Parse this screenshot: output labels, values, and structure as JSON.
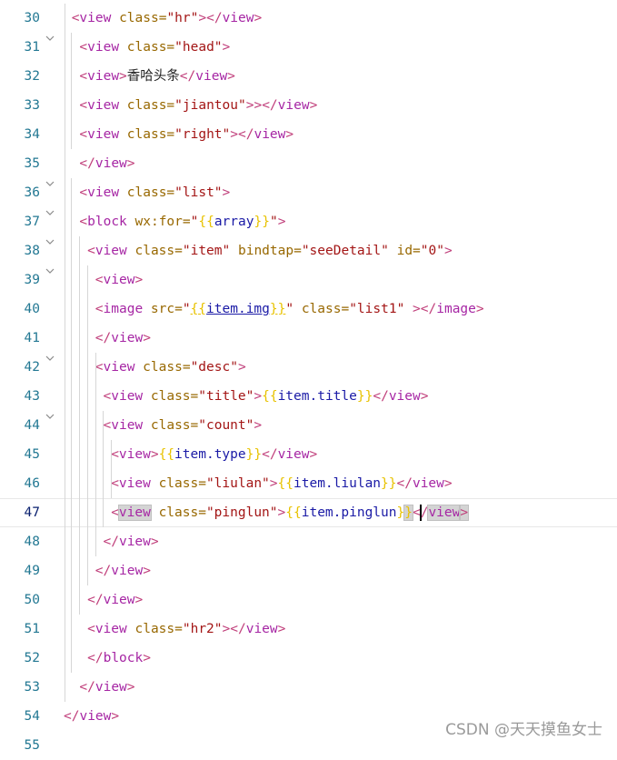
{
  "lines": [
    {
      "n": "30",
      "fold": "",
      "indent": 1,
      "tokens": [
        [
          "p",
          "<"
        ],
        [
          "t",
          "view"
        ],
        [
          "a",
          " class="
        ],
        [
          "s",
          "\"hr\""
        ],
        [
          "p",
          "></"
        ],
        [
          "t",
          "view"
        ],
        [
          "p",
          ">"
        ]
      ]
    },
    {
      "n": "31",
      "fold": "v",
      "indent": 2,
      "tokens": [
        [
          "p",
          "<"
        ],
        [
          "t",
          "view"
        ],
        [
          "a",
          " class="
        ],
        [
          "s",
          "\"head\""
        ],
        [
          "p",
          ">"
        ]
      ]
    },
    {
      "n": "32",
      "fold": "",
      "indent": 2,
      "tokens": [
        [
          "p",
          "<"
        ],
        [
          "t",
          "view"
        ],
        [
          "p",
          ">"
        ],
        [
          "x",
          "香哈头条"
        ],
        [
          "p",
          "</"
        ],
        [
          "t",
          "view"
        ],
        [
          "p",
          ">"
        ]
      ]
    },
    {
      "n": "33",
      "fold": "",
      "indent": 2,
      "tokens": [
        [
          "p",
          "<"
        ],
        [
          "t",
          "view"
        ],
        [
          "a",
          " class="
        ],
        [
          "s",
          "\"jiantou\""
        ],
        [
          "p",
          ">></"
        ],
        [
          "t",
          "view"
        ],
        [
          "p",
          ">"
        ]
      ]
    },
    {
      "n": "34",
      "fold": "",
      "indent": 2,
      "tokens": [
        [
          "p",
          "<"
        ],
        [
          "t",
          "view"
        ],
        [
          "a",
          " class="
        ],
        [
          "s",
          "\"right\""
        ],
        [
          "p",
          "></"
        ],
        [
          "t",
          "view"
        ],
        [
          "p",
          ">"
        ]
      ]
    },
    {
      "n": "35",
      "fold": "",
      "indent": 2,
      "tokens": [
        [
          "p",
          "</"
        ],
        [
          "t",
          "view"
        ],
        [
          "p",
          ">"
        ]
      ]
    },
    {
      "n": "36",
      "fold": "v",
      "indent": 2,
      "tokens": [
        [
          "p",
          "<"
        ],
        [
          "t",
          "view"
        ],
        [
          "a",
          " class="
        ],
        [
          "s",
          "\"list\""
        ],
        [
          "p",
          ">"
        ]
      ]
    },
    {
      "n": "37",
      "fold": "v",
      "indent": 2,
      "tokens": [
        [
          "p",
          "<"
        ],
        [
          "t",
          "block"
        ],
        [
          "a",
          " wx:for="
        ],
        [
          "s",
          "\""
        ],
        [
          "b",
          "{{"
        ],
        [
          "v",
          "array"
        ],
        [
          "b",
          "}}"
        ],
        [
          "s",
          "\""
        ],
        [
          "p",
          ">"
        ]
      ]
    },
    {
      "n": "38",
      "fold": "v",
      "indent": 3,
      "tokens": [
        [
          "p",
          "<"
        ],
        [
          "t",
          "view"
        ],
        [
          "a",
          " class="
        ],
        [
          "s",
          "\"item\""
        ],
        [
          "a",
          " bindtap="
        ],
        [
          "s",
          "\"seeDetail\""
        ],
        [
          "a",
          " id="
        ],
        [
          "s",
          "\"0\""
        ],
        [
          "p",
          ">"
        ]
      ]
    },
    {
      "n": "39",
      "fold": "v",
      "indent": 4,
      "tokens": [
        [
          "p",
          "<"
        ],
        [
          "t",
          "view"
        ],
        [
          "p",
          ">"
        ]
      ]
    },
    {
      "n": "40",
      "fold": "",
      "indent": 4,
      "tokens": [
        [
          "p",
          "<"
        ],
        [
          "t",
          "image"
        ],
        [
          "a",
          " src="
        ],
        [
          "s",
          "\""
        ],
        [
          "bl",
          "{{"
        ],
        [
          "vl",
          "item.img"
        ],
        [
          "bl",
          "}}"
        ],
        [
          "s",
          "\""
        ],
        [
          "a",
          " class="
        ],
        [
          "s",
          "\"list1\""
        ],
        [
          "p",
          " ></"
        ],
        [
          "t",
          "image"
        ],
        [
          "p",
          ">"
        ]
      ]
    },
    {
      "n": "41",
      "fold": "",
      "indent": 4,
      "tokens": [
        [
          "p",
          "</"
        ],
        [
          "t",
          "view"
        ],
        [
          "p",
          ">"
        ]
      ]
    },
    {
      "n": "42",
      "fold": "v",
      "indent": 4,
      "tokens": [
        [
          "p",
          "<"
        ],
        [
          "t",
          "view"
        ],
        [
          "a",
          " class="
        ],
        [
          "s",
          "\"desc\""
        ],
        [
          "p",
          ">"
        ]
      ]
    },
    {
      "n": "43",
      "fold": "",
      "indent": 5,
      "tokens": [
        [
          "p",
          "<"
        ],
        [
          "t",
          "view"
        ],
        [
          "a",
          " class="
        ],
        [
          "s",
          "\"title\""
        ],
        [
          "p",
          ">"
        ],
        [
          "b",
          "{{"
        ],
        [
          "v",
          "item.title"
        ],
        [
          "b",
          "}}"
        ],
        [
          "p",
          "</"
        ],
        [
          "t",
          "view"
        ],
        [
          "p",
          ">"
        ]
      ]
    },
    {
      "n": "44",
      "fold": "v",
      "indent": 5,
      "tokens": [
        [
          "p",
          "<"
        ],
        [
          "t",
          "view"
        ],
        [
          "a",
          " class="
        ],
        [
          "s",
          "\"count\""
        ],
        [
          "p",
          ">"
        ]
      ]
    },
    {
      "n": "45",
      "fold": "",
      "indent": 6,
      "tokens": [
        [
          "p",
          "<"
        ],
        [
          "t",
          "view"
        ],
        [
          "p",
          ">"
        ],
        [
          "b",
          "{{"
        ],
        [
          "v",
          "item.type"
        ],
        [
          "b",
          "}}"
        ],
        [
          "p",
          "</"
        ],
        [
          "t",
          "view"
        ],
        [
          "p",
          ">"
        ]
      ]
    },
    {
      "n": "46",
      "fold": "",
      "indent": 6,
      "tokens": [
        [
          "p",
          "<"
        ],
        [
          "t",
          "view"
        ],
        [
          "a",
          " class="
        ],
        [
          "s",
          "\"liulan\""
        ],
        [
          "p",
          ">"
        ],
        [
          "b",
          "{{"
        ],
        [
          "v",
          "item.liulan"
        ],
        [
          "b",
          "}}"
        ],
        [
          "p",
          "</"
        ],
        [
          "t",
          "view"
        ],
        [
          "p",
          ">"
        ]
      ]
    },
    {
      "n": "47",
      "fold": "",
      "indent": 6,
      "current": true,
      "tokens": [
        [
          "p",
          "<"
        ],
        [
          "th",
          "view"
        ],
        [
          "a",
          " class="
        ],
        [
          "s",
          "\"pinglun\""
        ],
        [
          "p",
          ">"
        ],
        [
          "b",
          "{{"
        ],
        [
          "v",
          "item.pinglun"
        ],
        [
          "b",
          "}"
        ],
        [
          "bh",
          "}"
        ],
        [
          "p",
          "<"
        ],
        [
          "cur",
          ""
        ],
        [
          "p",
          "/"
        ],
        [
          "th",
          "view"
        ],
        [
          "ph",
          ">"
        ]
      ]
    },
    {
      "n": "48",
      "fold": "",
      "indent": 5,
      "tokens": [
        [
          "p",
          "</"
        ],
        [
          "t",
          "view"
        ],
        [
          "p",
          ">"
        ]
      ]
    },
    {
      "n": "49",
      "fold": "",
      "indent": 4,
      "tokens": [
        [
          "p",
          "</"
        ],
        [
          "t",
          "view"
        ],
        [
          "p",
          ">"
        ]
      ]
    },
    {
      "n": "50",
      "fold": "",
      "indent": 3,
      "tokens": [
        [
          "p",
          "</"
        ],
        [
          "t",
          "view"
        ],
        [
          "p",
          ">"
        ]
      ]
    },
    {
      "n": "51",
      "fold": "",
      "indent": 3,
      "tokens": [
        [
          "p",
          "<"
        ],
        [
          "t",
          "view"
        ],
        [
          "a",
          " class="
        ],
        [
          "s",
          "\"hr2\""
        ],
        [
          "p",
          "></"
        ],
        [
          "t",
          "view"
        ],
        [
          "p",
          ">"
        ]
      ]
    },
    {
      "n": "52",
      "fold": "",
      "indent": 2,
      "tokens": [
        [
          "p",
          " </"
        ],
        [
          "t",
          "block"
        ],
        [
          "p",
          ">"
        ]
      ]
    },
    {
      "n": "53",
      "fold": "",
      "indent": 2,
      "tokens": [
        [
          "p",
          "</"
        ],
        [
          "t",
          "view"
        ],
        [
          "p",
          ">"
        ]
      ]
    },
    {
      "n": "54",
      "fold": "",
      "indent": 0,
      "tokens": [
        [
          "p",
          "</"
        ],
        [
          "t",
          "view"
        ],
        [
          "p",
          ">"
        ]
      ]
    },
    {
      "n": "55",
      "fold": "",
      "indent": 0,
      "tokens": []
    }
  ],
  "watermark": "CSDN @天天摸鱼女士"
}
